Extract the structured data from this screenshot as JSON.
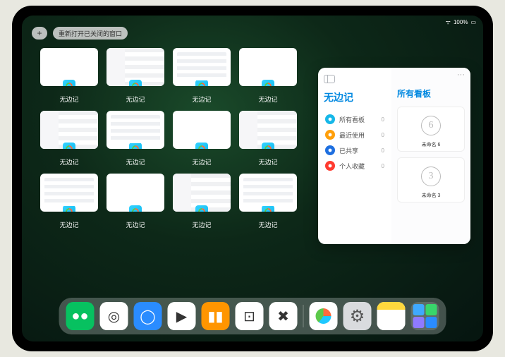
{
  "status": {
    "battery": "100%"
  },
  "topbar": {
    "add": "+",
    "reopen": "重新打开已关闭的窗口"
  },
  "app_label": "无边记",
  "float_window": {
    "nav_title": "无边记",
    "content_title": "所有看板",
    "more": "···",
    "items": [
      {
        "label": "所有看板",
        "count": 0,
        "color": "#16b7e8"
      },
      {
        "label": "最近使用",
        "count": 0,
        "color": "#ff9f0a"
      },
      {
        "label": "已共享",
        "count": 0,
        "color": "#1e6fe0"
      },
      {
        "label": "个人收藏",
        "count": 0,
        "color": "#ff3b30"
      }
    ],
    "boards": [
      {
        "glyph": "6",
        "label": "未命名 6",
        "sub": ""
      },
      {
        "glyph": "3",
        "label": "未命名 3",
        "sub": ""
      }
    ]
  },
  "thumbnail_layouts": [
    "a",
    "b",
    "c",
    "a",
    "b",
    "c",
    "a",
    "b",
    "c",
    "a",
    "b",
    "c"
  ],
  "dock": {
    "apps": [
      {
        "name": "wechat",
        "bg": "#07c160",
        "glyph": "●●"
      },
      {
        "name": "quark",
        "bg": "#ffffff",
        "glyph": "◎"
      },
      {
        "name": "qqbrowser",
        "bg": "#2a8cff",
        "glyph": "◯"
      },
      {
        "name": "play",
        "bg": "#ffffff",
        "glyph": "▶"
      },
      {
        "name": "books",
        "bg": "#ff9500",
        "glyph": "▮▮"
      },
      {
        "name": "dice",
        "bg": "#ffffff",
        "glyph": "⊡"
      },
      {
        "name": "connect",
        "bg": "#ffffff",
        "glyph": "✖"
      }
    ],
    "recent": [
      {
        "name": "freeform",
        "bg": "#ffffff"
      },
      {
        "name": "settings",
        "bg": "#d9dbde"
      },
      {
        "name": "notes",
        "bg": "#ffffff"
      }
    ]
  }
}
